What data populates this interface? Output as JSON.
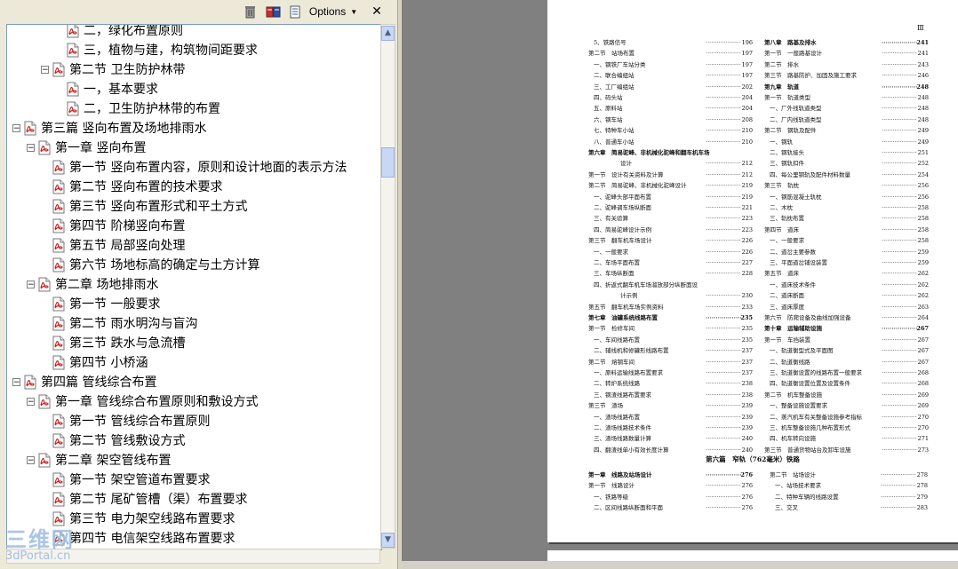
{
  "toolbar": {
    "options_label": "Options",
    "close_label": "✕"
  },
  "bookmarks": [
    {
      "label": "二，绿化布置原则",
      "level": 3,
      "type": "leaf"
    },
    {
      "label": "三，植物与建，构筑物间距要求",
      "level": 3,
      "type": "leaf"
    },
    {
      "label": "第二节 卫生防护林带",
      "level": 2,
      "type": "open"
    },
    {
      "label": "一，基本要求",
      "level": 3,
      "type": "leaf"
    },
    {
      "label": "二，卫生防护林带的布置",
      "level": 3,
      "type": "leaf"
    },
    {
      "label": "第三篇 竖向布置及场地排雨水",
      "level": 0,
      "type": "open"
    },
    {
      "label": "第一章 竖向布置",
      "level": 1,
      "type": "open"
    },
    {
      "label": "第一节 竖向布置内容，原则和设计地面的表示方法",
      "level": 2,
      "type": "leaf"
    },
    {
      "label": "第二节 竖向布置的技术要求",
      "level": 2,
      "type": "leaf"
    },
    {
      "label": "第三节 竖向布置形式和平土方式",
      "level": 2,
      "type": "leaf"
    },
    {
      "label": "第四节 阶梯竖向布置",
      "level": 2,
      "type": "leaf"
    },
    {
      "label": "第五节 局部竖向处理",
      "level": 2,
      "type": "leaf"
    },
    {
      "label": "第六节 场地标高的确定与土方计算",
      "level": 2,
      "type": "leaf"
    },
    {
      "label": "第二章 场地排雨水",
      "level": 1,
      "type": "open"
    },
    {
      "label": "第一节 一般要求",
      "level": 2,
      "type": "leaf"
    },
    {
      "label": "第二节 雨水明沟与盲沟",
      "level": 2,
      "type": "leaf"
    },
    {
      "label": "第三节 跌水与急流槽",
      "level": 2,
      "type": "leaf"
    },
    {
      "label": "第四节 小桥涵",
      "level": 2,
      "type": "leaf"
    },
    {
      "label": "第四篇 管线综合布置",
      "level": 0,
      "type": "open"
    },
    {
      "label": "第一章 管线综合布置原则和敷设方式",
      "level": 1,
      "type": "open"
    },
    {
      "label": "第一节 管线综合布置原则",
      "level": 2,
      "type": "leaf"
    },
    {
      "label": "第二节 管线敷设方式",
      "level": 2,
      "type": "leaf"
    },
    {
      "label": "第二章 架空管线布置",
      "level": 1,
      "type": "open"
    },
    {
      "label": "第一节 架空管道布置要求",
      "level": 2,
      "type": "leaf"
    },
    {
      "label": "第二节 尾矿管槽（渠）布置要求",
      "level": 2,
      "type": "leaf"
    },
    {
      "label": "第三节 电力架空线路布置要求",
      "level": 2,
      "type": "leaf"
    },
    {
      "label": "第四节 电信架空线路布置要求",
      "level": 2,
      "type": "leaf"
    }
  ],
  "page": {
    "page_marker": "Ⅲ",
    "left_column": [
      {
        "text": "5、铁路信号",
        "page": "196",
        "indent": 1
      },
      {
        "text": "第二节　站场布置",
        "page": "197",
        "indent": 0
      },
      {
        "text": "一、钢铁厂车站分类",
        "page": "197",
        "indent": 1
      },
      {
        "text": "二、联合编组站",
        "page": "197",
        "indent": 1
      },
      {
        "text": "三、工厂编组站",
        "page": "202",
        "indent": 1
      },
      {
        "text": "四、码头站",
        "page": "204",
        "indent": 1
      },
      {
        "text": "五、原料站",
        "page": "204",
        "indent": 1
      },
      {
        "text": "六、钢车站",
        "page": "208",
        "indent": 1
      },
      {
        "text": "七、特种车小站",
        "page": "210",
        "indent": 1
      },
      {
        "text": "八、普通车小站",
        "page": "210",
        "indent": 1
      },
      {
        "text": "第六章　简易驼峰、非机械化驼峰和翻车机车场",
        "page": "",
        "indent": 0,
        "bold": true
      },
      {
        "text": "设计",
        "page": "212",
        "indent": 2
      },
      {
        "text": "第一节　设计有关资料及计算",
        "page": "212",
        "indent": 0
      },
      {
        "text": "第二节　简易驼峰、非机械化驼峰设计",
        "page": "219",
        "indent": 0
      },
      {
        "text": "一、驼峰头部平面布置",
        "page": "219",
        "indent": 1
      },
      {
        "text": "二、驼峰调车场纵断面",
        "page": "221",
        "indent": 1
      },
      {
        "text": "三、有关验算",
        "page": "223",
        "indent": 1
      },
      {
        "text": "四、简易驼峰设计示例",
        "page": "223",
        "indent": 1
      },
      {
        "text": "第三节　翻车机车场设计",
        "page": "226",
        "indent": 0
      },
      {
        "text": "一、一般要求",
        "page": "226",
        "indent": 1
      },
      {
        "text": "二、车场平面布置",
        "page": "227",
        "indent": 1
      },
      {
        "text": "三、车场纵断面",
        "page": "228",
        "indent": 1
      },
      {
        "text": "四、折返式翻车机车场溜放部分纵断面设",
        "page": "",
        "indent": 1
      },
      {
        "text": "计示例",
        "page": "230",
        "indent": 2
      },
      {
        "text": "第五节　翻车机车场实例资料",
        "page": "233",
        "indent": 0
      },
      {
        "text": "第七章　油罐系统线路布置",
        "page": "235",
        "indent": 0,
        "bold": true
      },
      {
        "text": "第一节　检修车间",
        "page": "235",
        "indent": 0
      },
      {
        "text": "一、车间线路布置",
        "page": "235",
        "indent": 1
      },
      {
        "text": "二、辅线机和修罐形线路布置",
        "page": "237",
        "indent": 1
      },
      {
        "text": "第二节　熔钢车间",
        "page": "237",
        "indent": 0
      },
      {
        "text": "一、原料运输线路布置要求",
        "page": "237",
        "indent": 1
      },
      {
        "text": "二、转炉系统线路",
        "page": "238",
        "indent": 1
      },
      {
        "text": "三、钢渣线路布置要求",
        "page": "238",
        "indent": 1
      },
      {
        "text": "第三节　渣场",
        "page": "239",
        "indent": 0
      },
      {
        "text": "一、渣场线路布置",
        "page": "239",
        "indent": 1
      },
      {
        "text": "二、渣场线路技术条件",
        "page": "239",
        "indent": 1
      },
      {
        "text": "三、渣场线路数量计算",
        "page": "240",
        "indent": 1
      },
      {
        "text": "四、翻渣线单小有效长度计算",
        "page": "240",
        "indent": 1
      }
    ],
    "right_column": [
      {
        "text": "第八章　路基及排水",
        "page": "241",
        "indent": 0,
        "bold": true
      },
      {
        "text": "第一节　一般路基设计",
        "page": "241",
        "indent": 0
      },
      {
        "text": "第二节　排水",
        "page": "243",
        "indent": 0
      },
      {
        "text": "第三节　路基防护、加固及施工要求",
        "page": "246",
        "indent": 0
      },
      {
        "text": "第九章　轨道",
        "page": "248",
        "indent": 0,
        "bold": true
      },
      {
        "text": "第一节　轨道类型",
        "page": "248",
        "indent": 0
      },
      {
        "text": "一、厂外线轨道类型",
        "page": "248",
        "indent": 1
      },
      {
        "text": "二、厂内线轨道类型",
        "page": "248",
        "indent": 1
      },
      {
        "text": "第二节　钢轨及配件",
        "page": "249",
        "indent": 0
      },
      {
        "text": "一、钢轨",
        "page": "249",
        "indent": 1
      },
      {
        "text": "二、钢轨接头",
        "page": "251",
        "indent": 1
      },
      {
        "text": "三、钢轨扣件",
        "page": "252",
        "indent": 1
      },
      {
        "text": "四、每公里钢轨及配件材料数量",
        "page": "254",
        "indent": 1
      },
      {
        "text": "第三节　轨枕",
        "page": "256",
        "indent": 0
      },
      {
        "text": "一、钢筋混凝土轨枕",
        "page": "256",
        "indent": 1
      },
      {
        "text": "二、木枕",
        "page": "258",
        "indent": 1
      },
      {
        "text": "三、轨枕布置",
        "page": "258",
        "indent": 1
      },
      {
        "text": "第四节　道床",
        "page": "258",
        "indent": 0
      },
      {
        "text": "一、一般要求",
        "page": "258",
        "indent": 1
      },
      {
        "text": "二、道岔主要参数",
        "page": "259",
        "indent": 1
      },
      {
        "text": "三、平面道岔铺设装置",
        "page": "259",
        "indent": 1
      },
      {
        "text": "第五节　道床",
        "page": "262",
        "indent": 0
      },
      {
        "text": "一、道床技术条件",
        "page": "262",
        "indent": 1
      },
      {
        "text": "二、道床断面",
        "page": "262",
        "indent": 1
      },
      {
        "text": "三、道床厚度",
        "page": "263",
        "indent": 1
      },
      {
        "text": "第六节　防爬设备及曲线加强设备",
        "page": "264",
        "indent": 0
      },
      {
        "text": "第十章　运输辅助设施",
        "page": "267",
        "indent": 0,
        "bold": true
      },
      {
        "text": "第一节　车挡装置",
        "page": "267",
        "indent": 0
      },
      {
        "text": "一、轨道衡型式及平面图",
        "page": "267",
        "indent": 1
      },
      {
        "text": "二、轨道衡线路",
        "page": "267",
        "indent": 1
      },
      {
        "text": "三、轨道衡设置的线路布置一般要求",
        "page": "268",
        "indent": 1
      },
      {
        "text": "四、轨道衡设置位置及设置条件",
        "page": "268",
        "indent": 1
      },
      {
        "text": "第二节　机车整备设施",
        "page": "269",
        "indent": 0
      },
      {
        "text": "一、整备设施设置要求",
        "page": "269",
        "indent": 1
      },
      {
        "text": "二、蒸汽机车有关整备设施参考指标",
        "page": "270",
        "indent": 1
      },
      {
        "text": "三、机车整备设施几种布置形式",
        "page": "270",
        "indent": 1
      },
      {
        "text": "四、机车转向设施",
        "page": "271",
        "indent": 1
      },
      {
        "text": "第三节　普通货物站台及卸车设施",
        "page": "273",
        "indent": 0
      }
    ],
    "part_heading": "第六篇　窄轨（762毫米）铁路",
    "bottom_left": [
      {
        "text": "第一章　线路及站场设计",
        "page": "276",
        "indent": 0,
        "bold": true
      },
      {
        "text": "第一节　线路设计",
        "page": "276",
        "indent": 0
      },
      {
        "text": "一、铁路等级",
        "page": "276",
        "indent": 1
      },
      {
        "text": "二、区间线路纵断面和平面",
        "page": "276",
        "indent": 1
      }
    ],
    "bottom_right": [
      {
        "text": "第二节　站场设计",
        "page": "278",
        "indent": 0
      },
      {
        "text": "一、站场技术要求",
        "page": "278",
        "indent": 1
      },
      {
        "text": "二、特种车辆的线路设置",
        "page": "279",
        "indent": 1
      },
      {
        "text": "三、交叉",
        "page": "283",
        "indent": 1
      }
    ]
  },
  "watermark": {
    "brand": "三维网",
    "site": "3dPortal.cn"
  }
}
